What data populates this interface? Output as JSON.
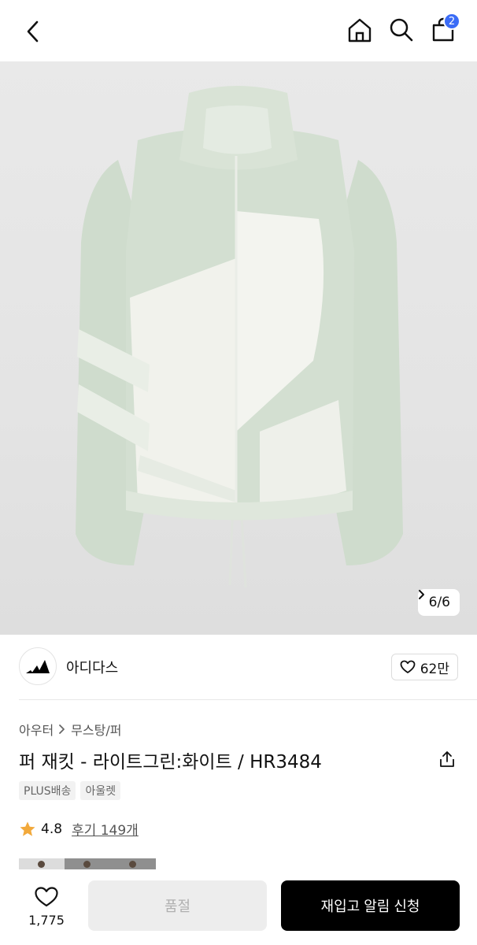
{
  "header": {
    "cart_count": "2"
  },
  "gallery": {
    "counter": "6/6"
  },
  "brand": {
    "name": "아디다스",
    "likes": "62만"
  },
  "product": {
    "breadcrumb": [
      "아우터",
      "무스탕/퍼"
    ],
    "title": "퍼 재킷 - 라이트그린:화이트 / HR3484",
    "tags": [
      "PLUS배송",
      "아울렛"
    ],
    "rating": "4.8",
    "reviews": "후기 149개"
  },
  "bottom": {
    "wish_count": "1,775",
    "soldout_label": "품절",
    "restock_label": "재입고 알림 신청"
  },
  "colors": {
    "accent_badge": "#3b6cf6",
    "star": "#f2a93b",
    "primary_button": "#000000"
  }
}
